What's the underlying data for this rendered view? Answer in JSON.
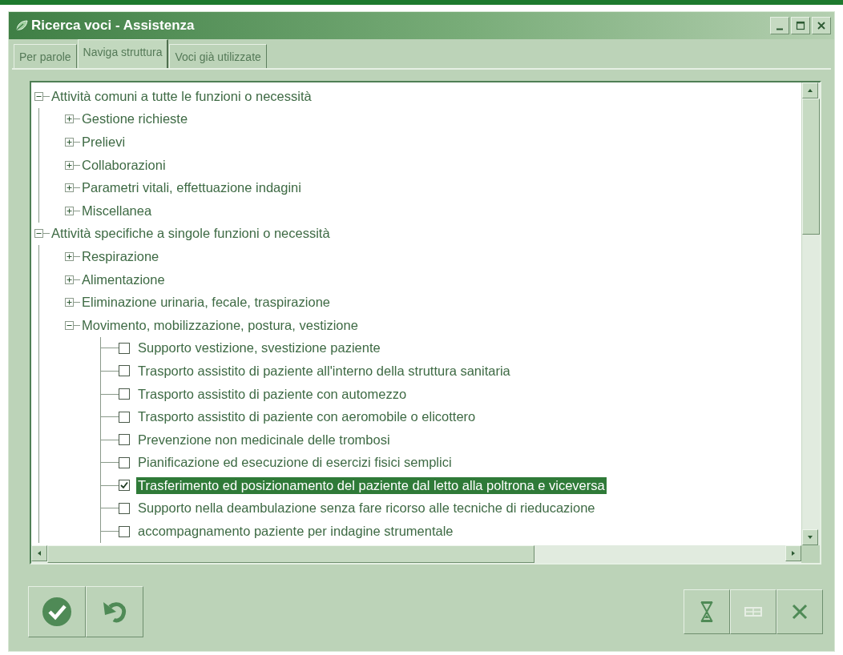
{
  "window": {
    "title": "Ricerca voci - Assistenza"
  },
  "tabs": [
    {
      "label": "Per parole",
      "selected": false
    },
    {
      "label": "Naviga struttura",
      "selected": true
    },
    {
      "label": "Voci già utilizzate",
      "selected": false
    }
  ],
  "tree": [
    {
      "label": "Attività comuni a tutte le funzioni o necessità",
      "expanded": true,
      "children": [
        {
          "label": "Gestione richieste",
          "expanded": false
        },
        {
          "label": "Prelievi",
          "expanded": false
        },
        {
          "label": "Collaborazioni",
          "expanded": false
        },
        {
          "label": "Parametri vitali, effettuazione indagini",
          "expanded": false
        },
        {
          "label": "Miscellanea",
          "expanded": false
        }
      ]
    },
    {
      "label": "Attività specifiche a singole funzioni o necessità",
      "expanded": true,
      "children": [
        {
          "label": "Respirazione",
          "expanded": false
        },
        {
          "label": "Alimentazione",
          "expanded": false
        },
        {
          "label": "Eliminazione urinaria, fecale, traspirazione",
          "expanded": false
        },
        {
          "label": "Movimento, mobilizzazione, postura, vestizione",
          "expanded": true,
          "children": [
            {
              "kind": "checkbox",
              "label": "Supporto vestizione, svestizione paziente",
              "checked": false,
              "selected": false
            },
            {
              "kind": "checkbox",
              "label": "Trasporto assistito di paziente all'interno della struttura sanitaria",
              "checked": false,
              "selected": false
            },
            {
              "kind": "checkbox",
              "label": "Trasporto assistito di paziente con automezzo",
              "checked": false,
              "selected": false
            },
            {
              "kind": "checkbox",
              "label": "Trasporto assistito di paziente con aeromobile o elicottero",
              "checked": false,
              "selected": false
            },
            {
              "kind": "checkbox",
              "label": "Prevenzione non medicinale delle trombosi",
              "checked": false,
              "selected": false
            },
            {
              "kind": "checkbox",
              "label": "Pianificazione ed esecuzione di esercizi fisici semplici",
              "checked": false,
              "selected": false
            },
            {
              "kind": "checkbox",
              "label": "Trasferimento ed posizionamento del paziente dal letto alla poltrona e viceversa",
              "checked": true,
              "selected": true
            },
            {
              "kind": "checkbox",
              "label": "Supporto nella deambulazione senza fare ricorso alle tecniche di rieducazione",
              "checked": false,
              "selected": false
            },
            {
              "kind": "checkbox",
              "label": "accompagnamento paziente per indagine strumentale",
              "checked": false,
              "selected": false
            }
          ]
        }
      ]
    }
  ],
  "left_buttons": [
    {
      "kind": "confirm",
      "disabled": false
    },
    {
      "kind": "undo",
      "disabled": false
    }
  ],
  "right_buttons": [
    {
      "kind": "hourglass",
      "disabled": false
    },
    {
      "kind": "grid",
      "disabled": true
    },
    {
      "kind": "close",
      "disabled": false
    }
  ]
}
